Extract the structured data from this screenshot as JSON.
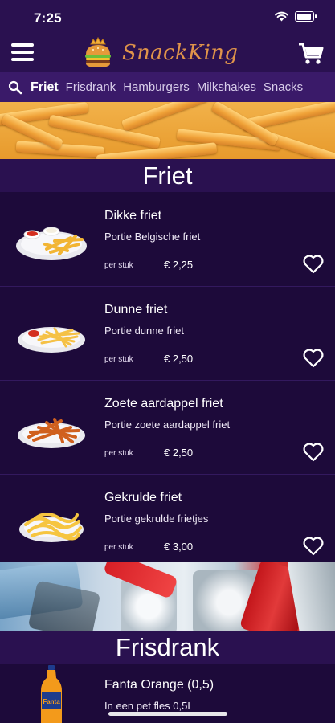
{
  "status": {
    "time": "7:25"
  },
  "header": {
    "brand": "SnackKing"
  },
  "tabs": [
    {
      "label": "Friet"
    },
    {
      "label": "Frisdrank"
    },
    {
      "label": "Hamburgers"
    },
    {
      "label": "Milkshakes"
    },
    {
      "label": "Snacks"
    }
  ],
  "sections": {
    "friet": {
      "title": "Friet",
      "items": [
        {
          "name": "Dikke friet",
          "desc": "Portie Belgische friet",
          "unit": "per stuk",
          "price": "€ 2,25"
        },
        {
          "name": "Dunne friet",
          "desc": "Portie dunne friet",
          "unit": "per stuk",
          "price": "€ 2,50"
        },
        {
          "name": "Zoete aardappel friet",
          "desc": "Portie zoete aardappel friet",
          "unit": "per stuk",
          "price": "€ 2,50"
        },
        {
          "name": "Gekrulde friet",
          "desc": "Portie gekrulde frietjes",
          "unit": "per stuk",
          "price": "€ 3,00"
        }
      ]
    },
    "frisdrank": {
      "title": "Frisdrank",
      "items": [
        {
          "name": "Fanta Orange (0,5)",
          "desc": "In een pet fles 0,5L"
        }
      ]
    }
  },
  "colors": {
    "background": "#1d0a3a",
    "header": "#2a1150",
    "tabbar": "#3a1a69",
    "brand": "#e0944a"
  },
  "icons": [
    "wifi-icon",
    "battery-icon",
    "menu-icon",
    "burger-logo-icon",
    "cart-icon",
    "search-icon",
    "heart-icon"
  ]
}
